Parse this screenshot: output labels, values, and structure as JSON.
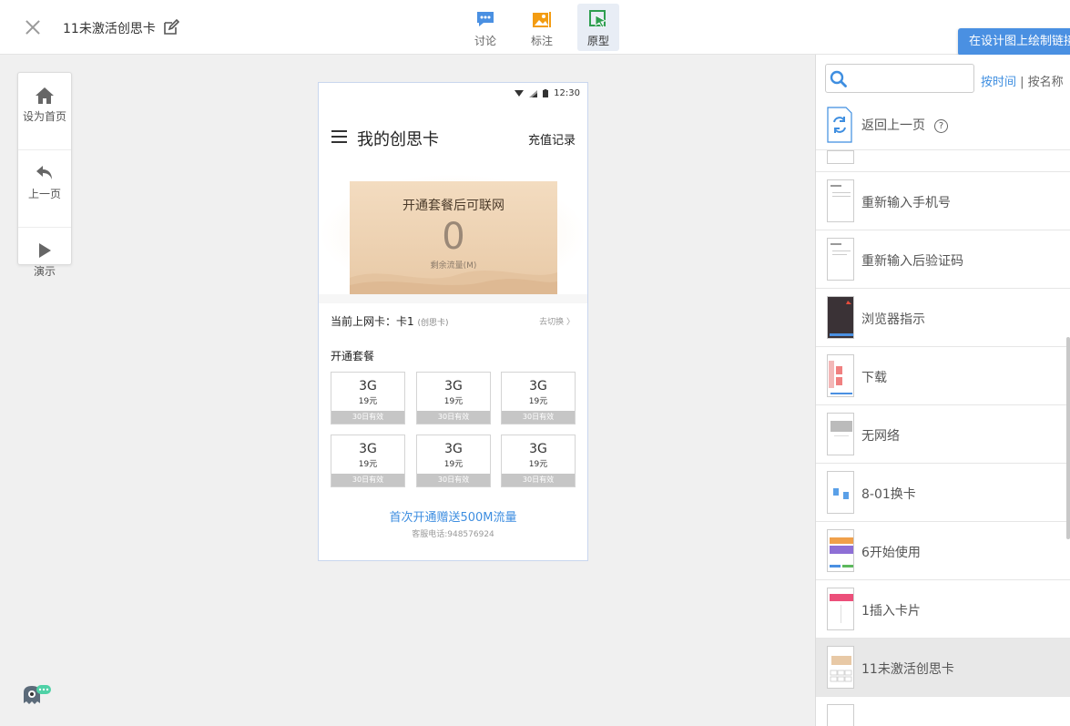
{
  "header": {
    "title": "11未激活创思卡",
    "tools": [
      {
        "label": "讨论"
      },
      {
        "label": "标注"
      },
      {
        "label": "原型"
      }
    ],
    "draw_link_label": "在设计图上绘制链接"
  },
  "left_tools": [
    {
      "label": "设为首页"
    },
    {
      "label": "上一页"
    },
    {
      "label": "演示"
    }
  ],
  "prototype": {
    "status_time": "12:30",
    "page_title": "我的创思卡",
    "recharge_label": "充值记录",
    "card": {
      "heading": "开通套餐后可联网",
      "data_value": "0",
      "data_caption": "剩余流量(M)"
    },
    "current_card_label": "当前上网卡：卡1",
    "current_card_note": "(创思卡)",
    "switch_label": "去切换 〉",
    "plans_heading": "开通套餐",
    "packages": [
      {
        "size": "3G",
        "price": "19元",
        "validity": "30日有效"
      },
      {
        "size": "3G",
        "price": "19元",
        "validity": "30日有效"
      },
      {
        "size": "3G",
        "price": "19元",
        "validity": "30日有效"
      },
      {
        "size": "3G",
        "price": "19元",
        "validity": "30日有效"
      },
      {
        "size": "3G",
        "price": "19元",
        "validity": "30日有效"
      },
      {
        "size": "3G",
        "price": "19元",
        "validity": "30日有效"
      }
    ],
    "promo": "首次开通赠送500M流量",
    "hotline": "客服电话:948576924"
  },
  "panel": {
    "search_placeholder": "",
    "sort_by_time": "按时间",
    "sort_separator": " | ",
    "sort_by_name": "按名称",
    "back_label": "返回上一页",
    "help_glyph": "?",
    "pages": [
      {
        "name": "重新输入手机号"
      },
      {
        "name": "重新输入后验证码"
      },
      {
        "name": "浏览器指示"
      },
      {
        "name": "下载"
      },
      {
        "name": "无网络"
      },
      {
        "name": "8-01换卡"
      },
      {
        "name": "6开始使用"
      },
      {
        "name": "1插入卡片"
      },
      {
        "name": "11未激活创思卡"
      }
    ],
    "active_index": 8
  },
  "colors": {
    "accent": "#3e8ee0",
    "draw_button": "#4a90e2",
    "tool_discuss": "#4a90e2",
    "tool_annotate": "#f39c12",
    "tool_prototype": "#2e9e4f"
  }
}
